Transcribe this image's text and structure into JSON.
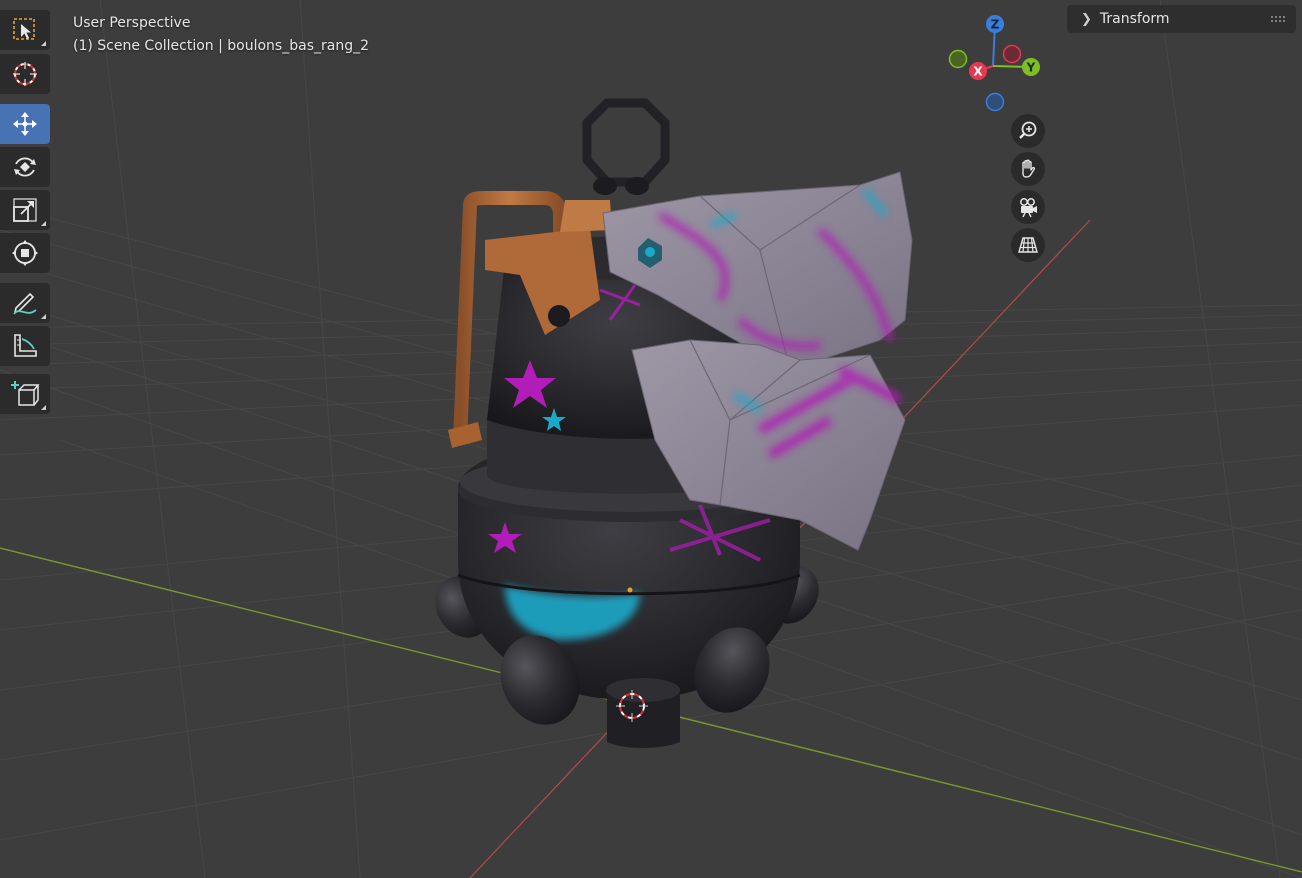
{
  "viewport": {
    "view_name": "User Perspective",
    "collection_line": "(1) Scene Collection | boulons_bas_rang_2"
  },
  "toolbar": {
    "tools": [
      {
        "name": "select-box",
        "icon": "select-box-icon",
        "active": false
      },
      {
        "name": "cursor",
        "icon": "cursor-icon",
        "active": false
      },
      {
        "name": "move",
        "icon": "move-icon",
        "active": true
      },
      {
        "name": "rotate",
        "icon": "rotate-icon",
        "active": false
      },
      {
        "name": "scale",
        "icon": "scale-icon",
        "active": false
      },
      {
        "name": "transform",
        "icon": "transform-icon",
        "active": false
      },
      {
        "name": "annotate",
        "icon": "annotate-icon",
        "active": false
      },
      {
        "name": "measure",
        "icon": "measure-icon",
        "active": false
      },
      {
        "name": "add-cube",
        "icon": "add-cube-icon",
        "active": false
      }
    ]
  },
  "gizmo": {
    "axes": [
      {
        "label": "Z",
        "color": "#3b7ddb"
      },
      {
        "label": "Y",
        "color": "#7fbf26"
      },
      {
        "label": "X",
        "color": "#e8374f"
      }
    ]
  },
  "nav_buttons": [
    {
      "name": "zoom",
      "icon": "zoom-icon"
    },
    {
      "name": "pan",
      "icon": "hand-icon"
    },
    {
      "name": "camera",
      "icon": "camera-icon"
    },
    {
      "name": "ortho",
      "icon": "grid-icon"
    }
  ],
  "sidebar": {
    "transform_label": "Transform"
  },
  "colors": {
    "viewport_bg": "#3d3d3d",
    "grid_line": "#474747",
    "x_axis": "#b34a4a",
    "y_axis": "#7b9a2a",
    "toolbar_bg": "#2b2b2b",
    "active_tool": "#4772b3",
    "body_dark": "#2a2a2e",
    "rust_metal": "#b06a3a",
    "shell_lilac": "#8c8595",
    "paint_magenta": "#b21cb8",
    "paint_cyan": "#1aa9c9"
  }
}
